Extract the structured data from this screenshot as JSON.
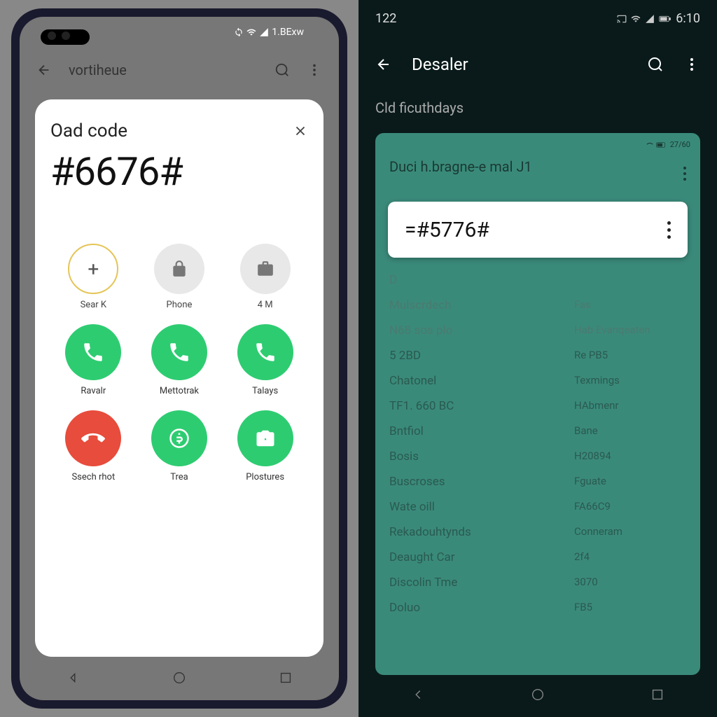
{
  "left": {
    "status_text": "1.BExw",
    "header_title": "vortiheue",
    "card_label": "Oad code",
    "code_value": "#6676#",
    "chips": [
      {
        "label": "Sear K",
        "glyph": "+"
      },
      {
        "label": "Phone",
        "glyph": "lock"
      },
      {
        "label": "4 M",
        "glyph": "briefcase"
      }
    ],
    "actions_row1": [
      {
        "label": "Ravalr",
        "type": "phone",
        "color": "green"
      },
      {
        "label": "Mettotrak",
        "type": "phone",
        "color": "green"
      },
      {
        "label": "Talays",
        "type": "phone",
        "color": "green"
      }
    ],
    "actions_row2": [
      {
        "label": "Ssech rhot",
        "type": "hangup",
        "color": "red"
      },
      {
        "label": "Trea",
        "type": "dollar",
        "color": "green"
      },
      {
        "label": "Plostures",
        "type": "camera",
        "color": "green"
      }
    ]
  },
  "right": {
    "status_left": "122",
    "status_time": "6:10",
    "header_title": "Desaler",
    "subhead": "Cld ficuthdays",
    "teal_status": "27/60",
    "teal_title": "Duci h.bragne-e mal J1",
    "popup_code": "=#5776#",
    "list": [
      {
        "k": "D",
        "v": ""
      },
      {
        "k": "Mulscrdech",
        "v": "Fas"
      },
      {
        "k": "N68 sos plo",
        "v": "Hab Evanqeaten"
      },
      {
        "k": "5 2BD",
        "v": "Re PB5"
      },
      {
        "k": "Chatonel",
        "v": "Texmings"
      },
      {
        "k": "TF1. 660 BC",
        "v": "HAbmenr"
      },
      {
        "k": "Bntfiol",
        "v": "Bane"
      },
      {
        "k": "Bosis",
        "v": "H20894"
      },
      {
        "k": "Buscroses",
        "v": "Fguate"
      },
      {
        "k": "Wate oill",
        "v": "FA66C9"
      },
      {
        "k": "Rekadouhtynds",
        "v": "Conneram"
      },
      {
        "k": "Deaught Car",
        "v": "2f4"
      },
      {
        "k": "Discolin Tme",
        "v": "3070"
      },
      {
        "k": "Doluo",
        "v": "FB5"
      }
    ]
  }
}
